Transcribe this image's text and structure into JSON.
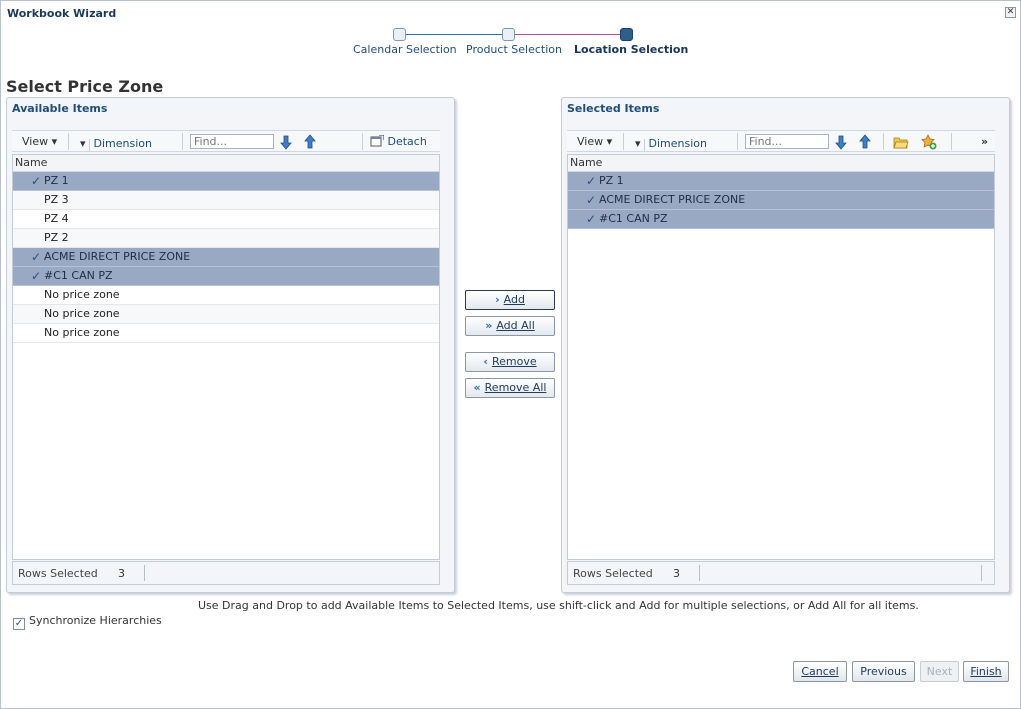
{
  "window": {
    "title": "Workbook Wizard",
    "close": "✕"
  },
  "train": {
    "steps": [
      {
        "label": "Calendar Selection"
      },
      {
        "label": "Product Selection"
      },
      {
        "label": "Location Selection"
      }
    ]
  },
  "page_title": "Select Price Zone",
  "available": {
    "title": "Available Items",
    "toolbar": {
      "view": "View",
      "dimension": "Dimension",
      "find_placeholder": "Find...",
      "detach": "Detach"
    },
    "column": "Name",
    "rows": [
      {
        "name": "PZ 1",
        "selected": true
      },
      {
        "name": "PZ 3",
        "selected": false
      },
      {
        "name": "PZ 4",
        "selected": false
      },
      {
        "name": "PZ 2",
        "selected": false
      },
      {
        "name": "ACME DIRECT PRICE ZONE",
        "selected": true
      },
      {
        "name": "#C1 CAN PZ",
        "selected": true
      },
      {
        "name": "No price zone",
        "selected": false
      },
      {
        "name": "No price zone",
        "selected": false
      },
      {
        "name": "No price zone",
        "selected": false
      }
    ],
    "status_label": "Rows Selected",
    "status_count": "3"
  },
  "selected": {
    "title": "Selected Items",
    "toolbar": {
      "view": "View",
      "dimension": "Dimension",
      "find_placeholder": "Find...",
      "more": "»"
    },
    "column": "Name",
    "rows": [
      {
        "name": "PZ 1",
        "selected": true
      },
      {
        "name": "ACME DIRECT PRICE ZONE",
        "selected": true
      },
      {
        "name": "#C1 CAN PZ",
        "selected": true
      }
    ],
    "status_label": "Rows Selected",
    "status_count": "3"
  },
  "shuttle": {
    "add": "Add",
    "add_all": "Add All",
    "remove": "Remove",
    "remove_all": "Remove All"
  },
  "hint": "Use Drag and Drop to add Available Items to Selected Items, use shift-click and Add for multiple selections, or Add All for all items.",
  "sync_label": "Synchronize Hierarchies",
  "sync_checked": true,
  "footer": {
    "cancel": "Cancel",
    "previous": "Previous",
    "next": "Next",
    "finish": "Finish"
  },
  "colors": {
    "selected_row": "#9aa9c3",
    "accent": "#1f4e7b",
    "current_step": "#2f5e8c"
  }
}
